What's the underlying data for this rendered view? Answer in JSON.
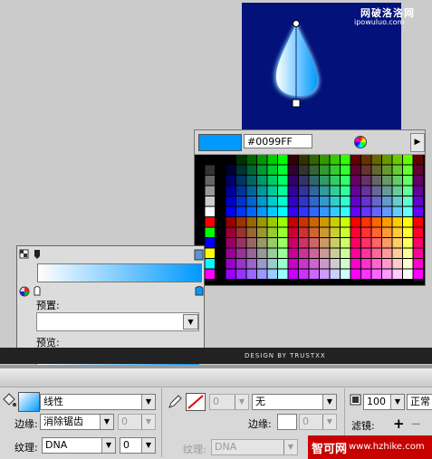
{
  "watermark": {
    "title": "网破洛洛网",
    "url": "ipowuluo.com"
  },
  "swatch_panel": {
    "hex_value": "#0099FF",
    "preview_color": "#0099ff",
    "menu_icon": "triangle-right-icon",
    "wheel_icon": "color-wheel-icon"
  },
  "gradient_panel": {
    "preset_label": "预置:",
    "preset_value": "",
    "preview_label": "预览:",
    "gradient_start": "#ffffff",
    "gradient_end": "#0099ff"
  },
  "credit": {
    "text": "DESIGN BY TRUSTXX"
  },
  "properties": {
    "fill_type": "线性",
    "edge_label": "边缘:",
    "edge_value": "消除锯齿",
    "edge_num": "0",
    "texture_label": "纹理:",
    "texture_value": "DNA",
    "texture_num": "0",
    "stroke_size": "0",
    "stroke_style": "无",
    "stroke_edge_label": "边缘:",
    "stroke_edge_num": "0",
    "stroke_texture_label": "纹理:",
    "stroke_texture_value": "DNA",
    "opacity": "100",
    "blend": "正常",
    "filters_label": "滤镜:"
  },
  "site_badge": {
    "brand": "智可网",
    "url": "www.hzhike.com"
  }
}
